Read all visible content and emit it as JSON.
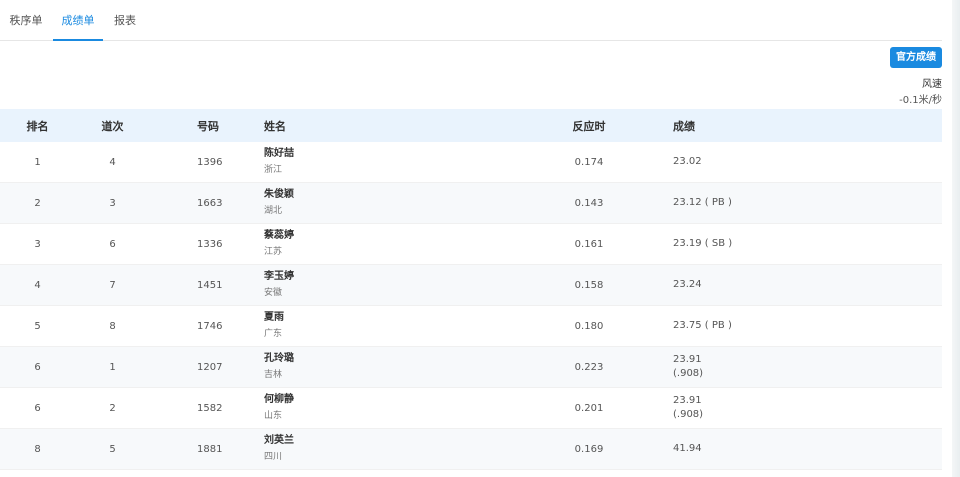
{
  "tabs": [
    {
      "label": "秩序单",
      "active": false
    },
    {
      "label": "成绩单",
      "active": true
    },
    {
      "label": "报表",
      "active": false
    }
  ],
  "official_button": "官方成绩",
  "wind": {
    "label": "风速",
    "value": "-0.1米/秒"
  },
  "columns": {
    "rank": "排名",
    "lane": "道次",
    "bib": "号码",
    "name": "姓名",
    "reaction": "反应时",
    "result": "成绩"
  },
  "rows": [
    {
      "rank": "1",
      "lane": "4",
      "bib": "1396",
      "name": "陈好喆",
      "province": "浙江",
      "reaction": "0.174",
      "result": "23.02",
      "result2": ""
    },
    {
      "rank": "2",
      "lane": "3",
      "bib": "1663",
      "name": "朱俊颖",
      "province": "湖北",
      "reaction": "0.143",
      "result": "23.12 ( PB )",
      "result2": ""
    },
    {
      "rank": "3",
      "lane": "6",
      "bib": "1336",
      "name": "蔡蕊婷",
      "province": "江苏",
      "reaction": "0.161",
      "result": "23.19 ( SB )",
      "result2": ""
    },
    {
      "rank": "4",
      "lane": "7",
      "bib": "1451",
      "name": "李玉婷",
      "province": "安徽",
      "reaction": "0.158",
      "result": "23.24",
      "result2": ""
    },
    {
      "rank": "5",
      "lane": "8",
      "bib": "1746",
      "name": "夏雨",
      "province": "广东",
      "reaction": "0.180",
      "result": "23.75 ( PB )",
      "result2": ""
    },
    {
      "rank": "6",
      "lane": "1",
      "bib": "1207",
      "name": "孔玲璐",
      "province": "吉林",
      "reaction": "0.223",
      "result": "23.91",
      "result2": "(.908)"
    },
    {
      "rank": "6",
      "lane": "2",
      "bib": "1582",
      "name": "何柳静",
      "province": "山东",
      "reaction": "0.201",
      "result": "23.91",
      "result2": "(.908)"
    },
    {
      "rank": "8",
      "lane": "5",
      "bib": "1881",
      "name": "刘英兰",
      "province": "四川",
      "reaction": "0.169",
      "result": "41.94",
      "result2": ""
    }
  ]
}
